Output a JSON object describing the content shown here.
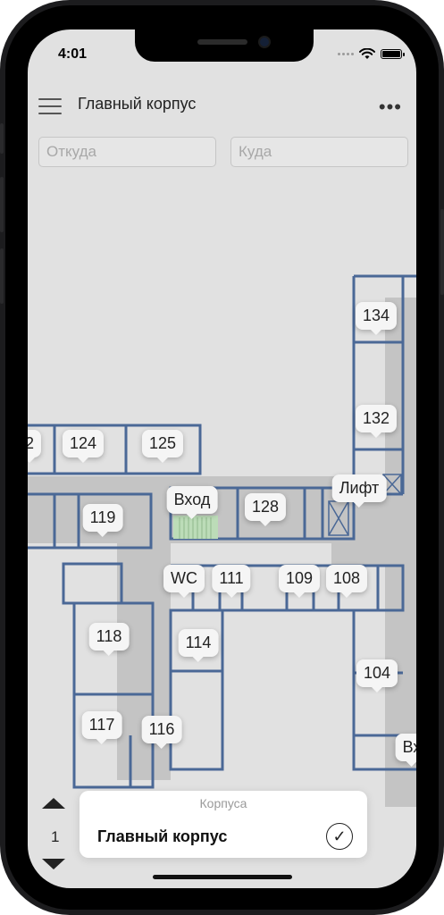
{
  "status_bar": {
    "time": "4:01",
    "wifi_icon": "wifi-icon",
    "battery_icon": "battery-icon"
  },
  "header": {
    "title": "Главный корпус",
    "menu_icon": "hamburger-icon",
    "more_icon": "ellipsis-icon",
    "more_label": "•••"
  },
  "route": {
    "from_placeholder": "Откуда",
    "to_placeholder": "Куда"
  },
  "map": {
    "labels": {
      "r134": "134",
      "r132": "132",
      "r2": "2",
      "r124": "124",
      "r125": "125",
      "lift": "Лифт",
      "entrance": "Вход",
      "r128": "128",
      "r119": "119",
      "wc": "WC",
      "r111": "111",
      "r109": "109",
      "r108": "108",
      "r118": "118",
      "r114": "114",
      "r104": "104",
      "r117": "117",
      "r116": "116",
      "entrance2": "Вх"
    },
    "colors": {
      "wall": "#4a6896",
      "corridor": "#c4c4c4",
      "room": "#e1e1e1",
      "entrance_fill": "#bcdcb8"
    }
  },
  "floor": {
    "current": "1",
    "up_icon": "triangle-up-icon",
    "down_icon": "triangle-down-icon"
  },
  "buildings_sheet": {
    "header": "Корпуса",
    "selected": "Главный корпус",
    "check": "✓"
  }
}
